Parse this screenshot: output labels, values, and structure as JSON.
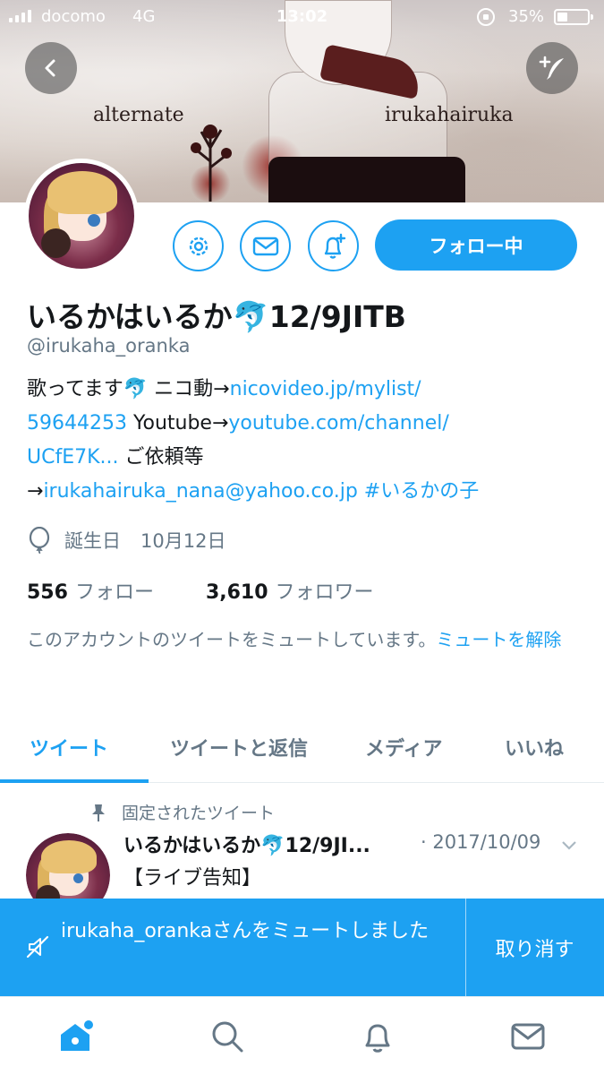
{
  "status_bar": {
    "carrier": "docomo",
    "network": "4G",
    "time": "13:02",
    "battery_percent": "35%",
    "battery_level": 0.35
  },
  "header": {
    "banner_text_left": "alternate",
    "banner_text_right": "irukahairuka"
  },
  "profile": {
    "display_name": "いるかはいるか🐬12/9JITB",
    "handle": "@irukaha_oranka",
    "bio": {
      "line1_prefix": "歌ってます🐬 ニコ動→",
      "line1_link": "nicovideo.jp/mylist/",
      "line2_link": "59644253",
      "line2_mid": " Youtube→",
      "line2_link2": "youtube.com/channel/",
      "line3_link": "UCfE7K...",
      "line3_suffix": " ご依頼等",
      "line4_prefix": "→",
      "line4_link": "irukahairuka_nana@yahoo.co.jp",
      "line4_space": " ",
      "line4_hashtag": "#いるかの子"
    },
    "birthday_label": "誕生日",
    "birthday_value": "10月12日",
    "following_count": "556",
    "following_label": "フォロー",
    "followers_count": "3,610",
    "followers_label": "フォロワー",
    "mute_note_text": "このアカウントのツイートをミュートしています。",
    "mute_note_link": "ミュートを解除",
    "follow_button_label": "フォロー中"
  },
  "tabs": [
    {
      "label": "ツイート",
      "active": true
    },
    {
      "label": "ツイートと返信",
      "active": false
    },
    {
      "label": "メディア",
      "active": false
    },
    {
      "label": "いいね",
      "active": false
    }
  ],
  "pinned_tweet": {
    "pinned_label": "固定されたツイート",
    "author": "いるかはいるか🐬12/9JI...",
    "date": "· 2017/10/09",
    "text": "【ライブ告知】"
  },
  "toast": {
    "message": "irukaha_orankaさんをミュートしました",
    "undo_label": "取り消す"
  },
  "colors": {
    "accent": "#1da1f2",
    "text_primary": "#14171a",
    "text_secondary": "#657786"
  },
  "icons": {
    "back": "chevron-left-icon",
    "compose": "compose-icon",
    "settings": "gear-icon",
    "dm": "envelope-icon",
    "notify": "bell-plus-icon",
    "birthday": "balloon-icon",
    "pin": "pin-icon",
    "mute": "mute-icon",
    "home": "home-icon",
    "search": "search-icon",
    "notifications": "bell-icon",
    "messages": "envelope-icon"
  }
}
